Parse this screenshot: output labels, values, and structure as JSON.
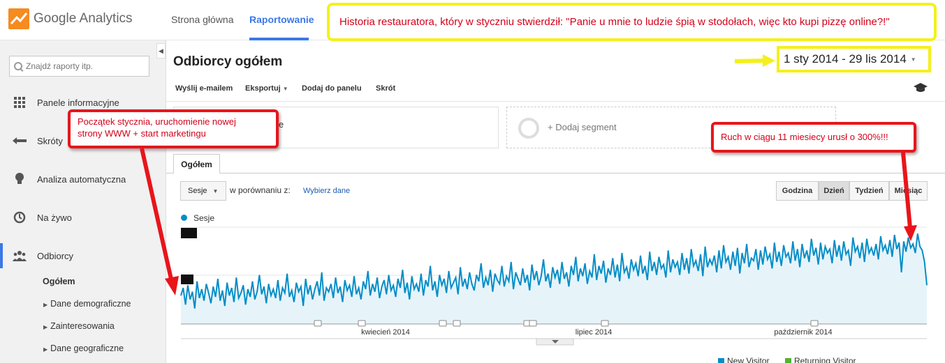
{
  "app": {
    "name_google": "Google",
    "name_product": "Analytics"
  },
  "nav": {
    "home": "Strona główna",
    "reports": "Raportowanie"
  },
  "sidebar": {
    "search_placeholder": "Znajdź raporty itp.",
    "items": [
      {
        "label": "Panele informacyjne",
        "icon": "grid-icon"
      },
      {
        "label": "Skróty",
        "icon": "shortcut-arrow-icon"
      },
      {
        "label": "Analiza automatyczna",
        "icon": "lightbulb-icon"
      },
      {
        "label": "Na żywo",
        "icon": "clock-icon"
      },
      {
        "label": "Odbiorcy",
        "icon": "people-icon"
      }
    ],
    "subitems": [
      "Ogółem",
      "Dane demograficzne",
      "Zainteresowania",
      "Dane geograficzne"
    ]
  },
  "page": {
    "title": "Odbiorcy ogółem",
    "date_range": "1 sty 2014 - 29 lis 2014"
  },
  "toolbar": {
    "email": "Wyślij e-mailem",
    "export": "Eksportuj",
    "add_panel": "Dodaj do panelu",
    "shortcut": "Skrót"
  },
  "segments": {
    "current_fragment": "je",
    "add": "+ Dodaj segment"
  },
  "tab": {
    "overview": "Ogółem"
  },
  "controls": {
    "metric": "Sesje",
    "compare_label": "w porównaniu z:",
    "compare_link": "Wybierz dane",
    "granularity": [
      "Godzina",
      "Dzień",
      "Tydzień",
      "Miesiąc"
    ],
    "granularity_active": "Dzień"
  },
  "legend": {
    "series": "Sesje",
    "new_visitor": "New Visitor",
    "returning_visitor": "Returning Visitor"
  },
  "annotations": {
    "top": "Historia restauratora, który w styczniu stwierdził: \"Panie u mnie to ludzie śpią w stodołach, więc kto kupi pizzę online?!\"",
    "left_line1": "Początek stycznia, uruchomienie nowej",
    "left_line2": "strony WWW + start marketingu",
    "right": "Ruch w ciągu 11 miesiecy urusł o 300%!!!"
  },
  "colors": {
    "series": "#058dc7",
    "fill": "#e6f4fa",
    "accent": "#3b78e7",
    "annotation_red": "#e8151b",
    "annotation_yellow": "#f5f01a",
    "returning": "#50b432"
  },
  "chart_data": {
    "type": "line",
    "series_name": "Sesje",
    "x_labels": [
      "kwiecień 2014",
      "lipiec 2014",
      "październik 2014"
    ],
    "x_start": "2014-01-01",
    "x_end": "2014-11-29",
    "values": [
      22,
      28,
      15,
      30,
      19,
      25,
      12,
      33,
      20,
      27,
      18,
      31,
      24,
      16,
      29,
      21,
      35,
      18,
      26,
      14,
      32,
      22,
      28,
      17,
      36,
      20,
      24,
      30,
      15,
      27,
      21,
      33,
      19,
      25,
      38,
      23,
      29,
      16,
      31,
      22,
      27,
      20,
      34,
      18,
      28,
      24,
      39,
      21,
      26,
      17,
      32,
      25,
      29,
      14,
      35,
      23,
      30,
      19,
      27,
      33,
      22,
      40,
      18,
      28,
      25,
      31,
      20,
      36,
      24,
      29,
      17,
      34,
      26,
      30,
      21,
      37,
      23,
      28,
      19,
      33,
      27,
      41,
      22,
      31,
      25,
      36,
      20,
      29,
      34,
      23,
      38,
      26,
      30,
      21,
      35,
      28,
      42,
      24,
      32,
      19,
      37,
      27,
      31,
      25,
      39,
      22,
      34,
      29,
      45,
      26,
      33,
      21,
      38,
      30,
      35,
      24,
      41,
      28,
      32,
      36,
      23,
      44,
      29,
      35,
      27,
      40,
      31,
      26,
      38,
      33,
      47,
      28,
      36,
      30,
      42,
      25,
      39,
      34,
      31,
      45,
      29,
      37,
      33,
      48,
      27,
      40,
      35,
      30,
      43,
      32,
      38,
      26,
      46,
      34,
      41,
      30,
      37,
      50,
      33,
      39,
      28,
      44,
      36,
      42,
      31,
      48,
      35,
      40,
      29,
      45,
      38,
      52,
      33,
      43,
      37,
      47,
      31,
      41,
      36,
      54,
      34,
      45,
      39,
      49,
      32,
      43,
      38,
      51,
      36,
      46,
      33,
      55,
      40,
      44,
      35,
      50,
      42,
      47,
      37,
      53,
      39,
      45,
      34,
      56,
      41,
      48,
      38,
      52,
      43,
      46,
      36,
      57,
      40,
      50,
      44,
      48,
      38,
      55,
      42,
      51,
      39,
      58,
      45,
      49,
      41,
      54,
      37,
      60,
      44,
      50,
      46,
      53,
      40,
      57,
      43,
      61,
      48,
      52,
      42,
      56,
      45,
      59,
      39,
      55,
      47,
      62,
      44,
      51,
      49,
      58,
      42,
      57,
      46,
      60,
      50,
      54,
      43,
      63,
      48,
      56,
      45,
      61,
      52,
      55,
      47,
      64,
      49,
      58,
      44,
      62,
      51,
      57,
      48,
      66,
      53,
      59,
      46,
      63,
      50,
      60,
      55,
      58,
      47,
      65,
      52,
      61,
      49,
      64,
      54,
      57,
      45,
      67,
      56,
      60,
      51,
      63,
      48,
      66,
      55,
      59,
      53,
      62,
      50,
      68,
      57,
      61,
      54,
      65,
      52,
      69,
      58,
      63,
      40,
      64,
      56,
      67,
      59,
      62,
      55,
      70,
      60,
      57,
      48,
      30
    ]
  }
}
